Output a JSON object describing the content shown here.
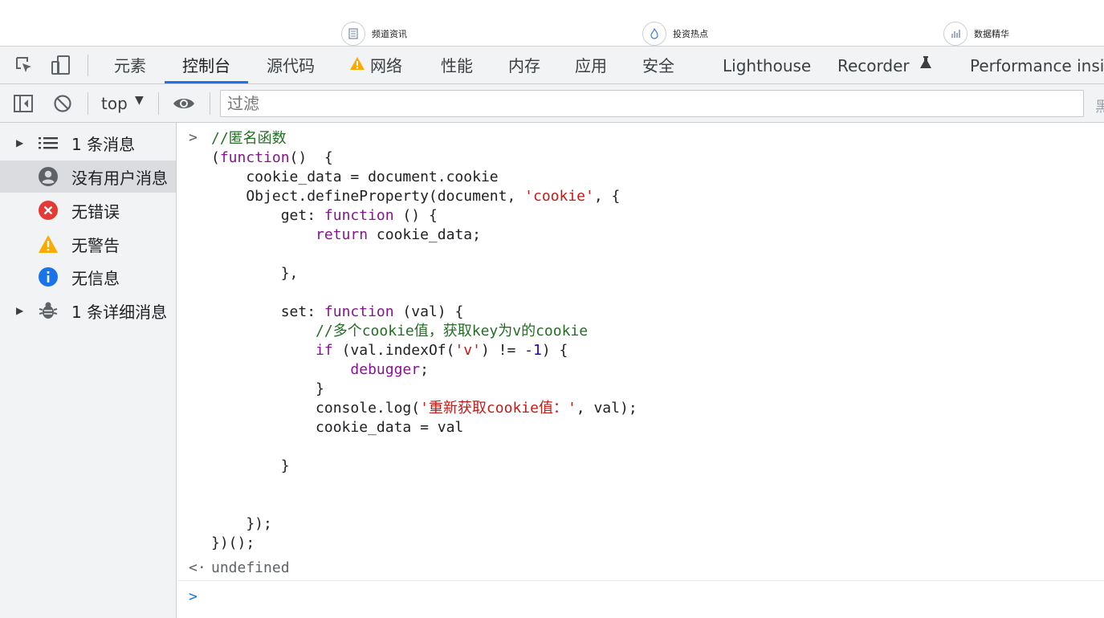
{
  "page_strip": {
    "items": [
      {
        "label": "频道资讯",
        "icon": "document-icon"
      },
      {
        "label": "投资热点",
        "icon": "flame-icon"
      },
      {
        "label": "数据精华",
        "icon": "bar-chart-icon"
      }
    ]
  },
  "tabs": {
    "elements": "元素",
    "console": "控制台",
    "sources": "源代码",
    "network": "网络",
    "performance": "性能",
    "memory": "内存",
    "application": "应用",
    "security": "安全",
    "lighthouse": "Lighthouse",
    "recorder": "Recorder",
    "perf_insights": "Performance insig"
  },
  "toolbar": {
    "context": "top",
    "filter_placeholder": "过滤",
    "edge_char": "黑"
  },
  "sidebar": {
    "items": [
      {
        "label": "1 条消息",
        "icon": "list-icon"
      },
      {
        "label": "没有用户消息",
        "icon": "user-icon"
      },
      {
        "label": "无错误",
        "icon": "error-icon"
      },
      {
        "label": "无警告",
        "icon": "warning-icon"
      },
      {
        "label": "无信息",
        "icon": "info-icon"
      },
      {
        "label": "1 条详细消息",
        "icon": "bug-icon"
      }
    ]
  },
  "console": {
    "code_lines": [
      [
        {
          "t": "//匿名函数",
          "c": "cmt"
        }
      ],
      [
        {
          "t": "("
        },
        {
          "t": "function",
          "c": "kw"
        },
        {
          "t": "()  {"
        }
      ],
      [
        {
          "t": "    cookie_data = document.cookie"
        }
      ],
      [
        {
          "t": "    Object.defineProperty(document, "
        },
        {
          "t": "'cookie'",
          "c": "str"
        },
        {
          "t": ", {"
        }
      ],
      [
        {
          "t": "        get: "
        },
        {
          "t": "function",
          "c": "kw"
        },
        {
          "t": " () {"
        }
      ],
      [
        {
          "t": "            "
        },
        {
          "t": "return",
          "c": "kw"
        },
        {
          "t": " cookie_data;"
        }
      ],
      [
        {
          "t": ""
        }
      ],
      [
        {
          "t": "        },"
        }
      ],
      [
        {
          "t": ""
        }
      ],
      [
        {
          "t": "        set: "
        },
        {
          "t": "function",
          "c": "kw"
        },
        {
          "t": " (val) {"
        }
      ],
      [
        {
          "t": "            "
        },
        {
          "t": "//多个cookie值，获取key为v的cookie",
          "c": "cmt"
        }
      ],
      [
        {
          "t": "            "
        },
        {
          "t": "if",
          "c": "kw"
        },
        {
          "t": " (val.indexOf("
        },
        {
          "t": "'v'",
          "c": "str"
        },
        {
          "t": ") != -"
        },
        {
          "t": "1",
          "c": "num"
        },
        {
          "t": ") {"
        }
      ],
      [
        {
          "t": "                "
        },
        {
          "t": "debugger",
          "c": "kw"
        },
        {
          "t": ";"
        }
      ],
      [
        {
          "t": "            }"
        }
      ],
      [
        {
          "t": "            console.log("
        },
        {
          "t": "'重新获取cookie值：'",
          "c": "str"
        },
        {
          "t": ", val);"
        }
      ],
      [
        {
          "t": "            cookie_data = val"
        }
      ],
      [
        {
          "t": ""
        }
      ],
      [
        {
          "t": "        }"
        }
      ],
      [
        {
          "t": ""
        }
      ],
      [
        {
          "t": ""
        }
      ],
      [
        {
          "t": "    });"
        }
      ],
      [
        {
          "t": "})();"
        }
      ]
    ],
    "result": "undefined"
  }
}
